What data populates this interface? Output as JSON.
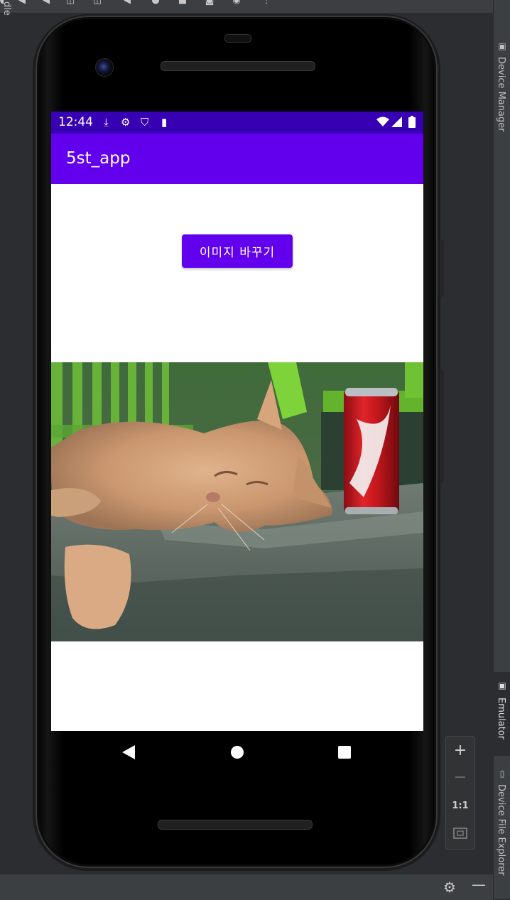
{
  "ide": {
    "right_tools": {
      "truncated_top": "dle",
      "device_manager": "Device Manager",
      "emulator": "Emulator",
      "device_file_explorer": "Device File Explorer"
    },
    "zoom": {
      "zoom_in": "+",
      "zoom_out": "−",
      "actual_size": "1:1"
    }
  },
  "device": {
    "status_bar": {
      "time": "12:44"
    },
    "app": {
      "title": "5st_app",
      "change_image_button": "이미지 바꾸기"
    }
  },
  "colors": {
    "status_bar": "#3700b3",
    "app_bar": "#6200ee",
    "button": "#6200ee",
    "ide_background": "#2b2d30"
  }
}
